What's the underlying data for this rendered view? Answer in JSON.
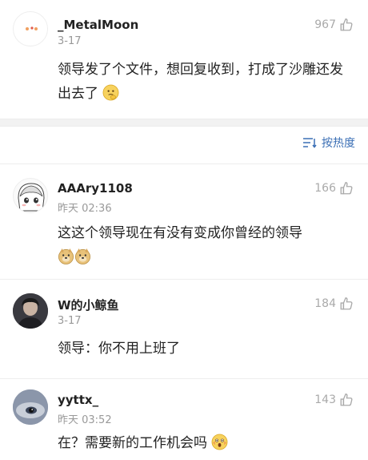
{
  "comments": [
    {
      "username": "_MetalMoon",
      "time": "3-17",
      "likes": "967",
      "text": "领导发了个文件，想回复收到，打成了沙雕还发出去了",
      "emoji": "thinking-face-emoji"
    },
    {
      "username": "AAAry1108",
      "time": "昨天 02:36",
      "likes": "166",
      "text": "这这个领导现在有没有变成你曾经的领导",
      "emoji": "doge-emoji"
    },
    {
      "username": "W的小鲸鱼",
      "time": "3-17",
      "likes": "184",
      "text": "领导：你不用上班了",
      "emoji": ""
    },
    {
      "username": "yyttx_",
      "time": "昨天 03:52",
      "likes": "143",
      "text": "在？需要新的工作机会吗",
      "emoji": "shocked-face-emoji"
    }
  ],
  "sort": {
    "label": "按热度",
    "icon": "sort-icon"
  },
  "colors": {
    "accent": "#3b6fb5",
    "muted": "#999999",
    "separator": "#f2f2f2"
  }
}
